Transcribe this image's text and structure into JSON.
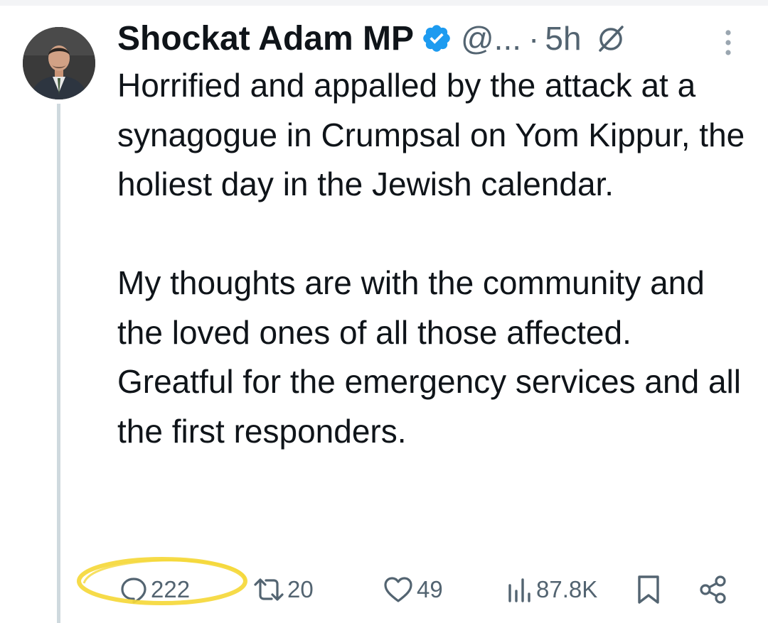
{
  "author": {
    "name": "Shockat Adam MP",
    "handle": "@...",
    "separator": "·",
    "time": "5h"
  },
  "tweet": {
    "paragraph1": "Horrified and appalled by the attack at a synagogue in Crumpsal on Yom Kippur, the holiest day in the Jewish calendar.",
    "paragraph2": "My thoughts are with the community and the loved ones of all those affected. Greatful for the emergency services and all the first responders."
  },
  "actions": {
    "replies": "222",
    "reposts": "20",
    "likes": "49",
    "views": "87.8K"
  },
  "icons": {
    "verified": "verified-badge-icon",
    "grok": "grok-icon",
    "more": "more-vertical-icon",
    "reply": "reply-icon",
    "repost": "repost-icon",
    "like": "heart-icon",
    "views": "views-chart-icon",
    "bookmark": "bookmark-icon",
    "share": "share-icon"
  },
  "colors": {
    "verified": "#1d9bf0",
    "text": "#0f1419",
    "muted": "#536471",
    "highlight": "#f5d83a",
    "thread_line": "#cfd9de"
  }
}
